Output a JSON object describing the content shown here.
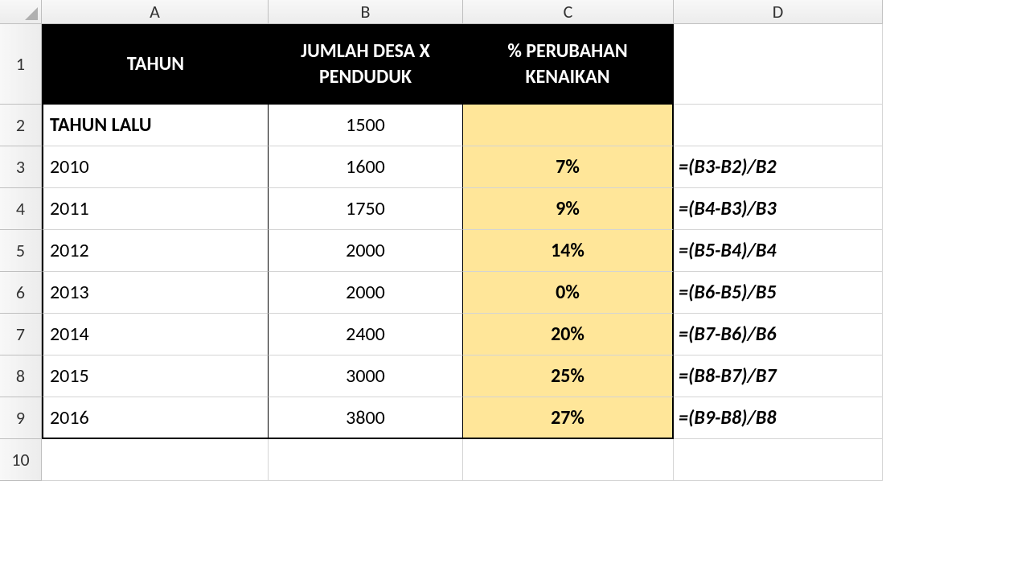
{
  "columns": {
    "A": "A",
    "B": "B",
    "C": "C",
    "D": "D"
  },
  "rowLabels": {
    "r1": "1",
    "r2": "2",
    "r3": "3",
    "r4": "4",
    "r5": "5",
    "r6": "6",
    "r7": "7",
    "r8": "8",
    "r9": "9",
    "r10": "10"
  },
  "headers": {
    "tahun": "TAHUN",
    "jumlah": "JUMLAH DESA X PENDUDUK",
    "perubahan": "% PERUBAHAN KENAIKAN"
  },
  "rows": [
    {
      "tahun": "TAHUN LALU",
      "jumlah": "1500",
      "perubahan": "",
      "formula": ""
    },
    {
      "tahun": "2010",
      "jumlah": "1600",
      "perubahan": "7%",
      "formula": "=(B3-B2)/B2"
    },
    {
      "tahun": "2011",
      "jumlah": "1750",
      "perubahan": "9%",
      "formula": "=(B4-B3)/B3"
    },
    {
      "tahun": "2012",
      "jumlah": "2000",
      "perubahan": "14%",
      "formula": "=(B5-B4)/B4"
    },
    {
      "tahun": "2013",
      "jumlah": "2000",
      "perubahan": "0%",
      "formula": "=(B6-B5)/B5"
    },
    {
      "tahun": "2014",
      "jumlah": "2400",
      "perubahan": "20%",
      "formula": "=(B7-B6)/B6"
    },
    {
      "tahun": "2015",
      "jumlah": "3000",
      "perubahan": "25%",
      "formula": "=(B8-B7)/B7"
    },
    {
      "tahun": "2016",
      "jumlah": "3800",
      "perubahan": "27%",
      "formula": "=(B9-B8)/B8"
    }
  ]
}
